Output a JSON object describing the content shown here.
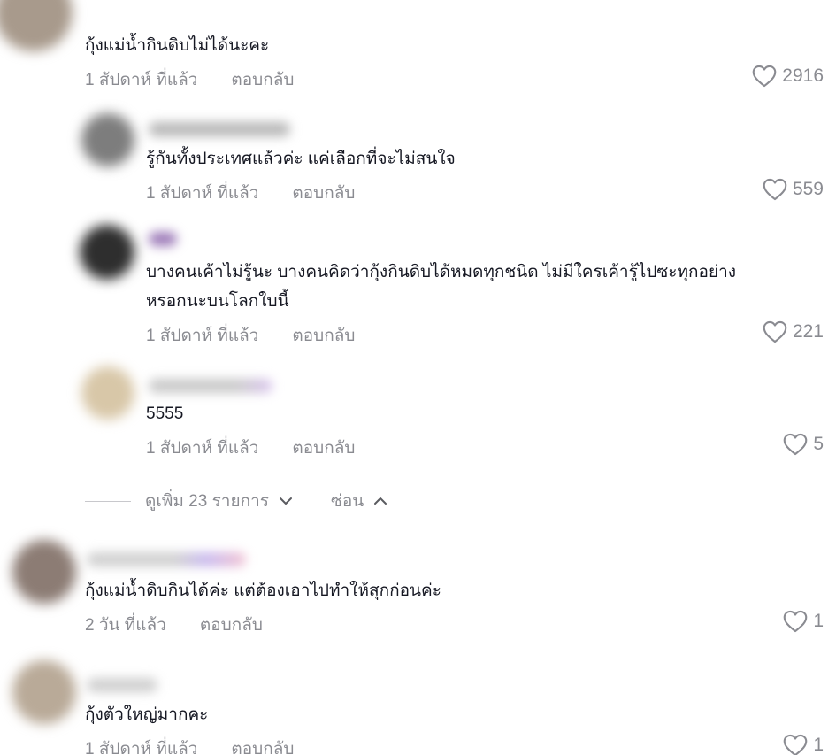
{
  "comments": [
    {
      "text": "กุ้งแม่น้ำกินดิบไม่ได้นะคะ",
      "time": "1 สัปดาห์ ที่แล้ว",
      "reply": "ตอบกลับ",
      "likes": "2916",
      "replies": [
        {
          "text": "รู้กันทั้งประเทศแล้วค่ะ แค่เลือกที่จะไม่สนใจ",
          "time": "1 สัปดาห์ ที่แล้ว",
          "reply": "ตอบกลับ",
          "likes": "559"
        },
        {
          "text_line1": "บางคนเค้าไม่รู้นะ บางคนคิดว่ากุ้งกินดิบได้หมดทุกชนิด ไม่มีใครเค้ารู้ไปซะทุกอย่าง",
          "text_line2": "หรอกนะบนโลกใบนี้",
          "time": "1 สัปดาห์ ที่แล้ว",
          "reply": "ตอบกลับ",
          "likes": "221"
        },
        {
          "text": "5555",
          "time": "1 สัปดาห์ ที่แล้ว",
          "reply": "ตอบกลับ",
          "likes": "5"
        }
      ],
      "view_more": "ดูเพิ่ม 23 รายการ",
      "hide": "ซ่อน"
    },
    {
      "text": "กุ้งแม่น้ำดิบกินได้ค่ะ แต่ต้องเอาไปทำให้สุกก่อนค่ะ",
      "time": "2 วัน ที่แล้ว",
      "reply": "ตอบกลับ",
      "likes": "1"
    },
    {
      "text": "กุ้งตัวใหญ่มากคะ",
      "time": "1 สัปดาห์ ที่แล้ว",
      "reply": "ตอบกลับ",
      "likes": "1"
    }
  ],
  "icons": {
    "like": "heart-outline-icon",
    "expand": "chevron-down-icon",
    "collapse": "chevron-up-icon"
  },
  "colors": {
    "text": "#161823",
    "muted": "#8a8b91"
  }
}
